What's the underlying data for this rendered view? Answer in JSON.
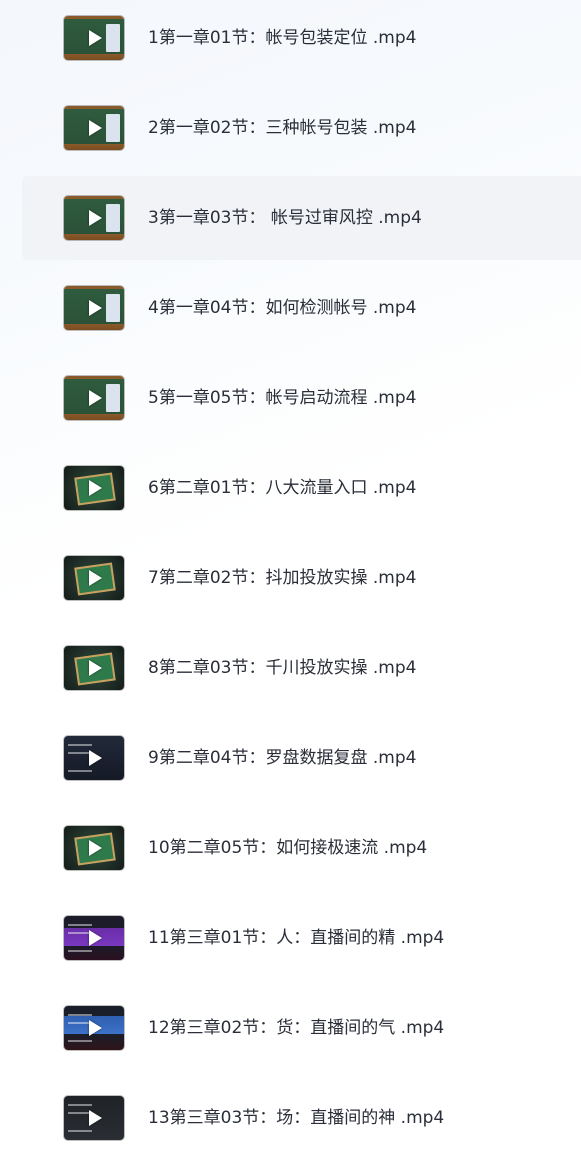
{
  "files": [
    {
      "name": "1第一章01节：帐号包装定位 .mp4",
      "thumb": "green",
      "icon": "play-icon",
      "selected": false
    },
    {
      "name": "2第一章02节：三种帐号包装 .mp4",
      "thumb": "green",
      "icon": "play-icon",
      "selected": false
    },
    {
      "name": "3第一章03节： 帐号过审风控 .mp4",
      "thumb": "green",
      "icon": "play-icon",
      "selected": true
    },
    {
      "name": "4第一章04节：如何检测帐号 .mp4",
      "thumb": "green",
      "icon": "play-icon",
      "selected": false
    },
    {
      "name": "5第一章05节：帐号启动流程 .mp4",
      "thumb": "green",
      "icon": "play-icon",
      "selected": false
    },
    {
      "name": "6第二章01节：八大流量入口 .mp4",
      "thumb": "board",
      "icon": "play-icon",
      "selected": false
    },
    {
      "name": "7第二章02节：抖加投放实操 .mp4",
      "thumb": "board",
      "icon": "play-icon",
      "selected": false
    },
    {
      "name": "8第二章03节：千川投放实操 .mp4",
      "thumb": "board",
      "icon": "play-icon",
      "selected": false
    },
    {
      "name": "9第二章04节：罗盘数据复盘 .mp4",
      "thumb": "dark",
      "icon": "play-icon",
      "selected": false
    },
    {
      "name": "10第二章05节：如何接极速流 .mp4",
      "thumb": "board",
      "icon": "play-icon",
      "selected": false
    },
    {
      "name": "11第三章01节：人：直播间的精 .mp4",
      "thumb": "purple",
      "icon": "play-icon",
      "selected": false
    },
    {
      "name": "12第三章02节：货：直播间的气 .mp4",
      "thumb": "blue",
      "icon": "play-icon",
      "selected": false
    },
    {
      "name": "13第三章03节：场：直播间的神 .mp4",
      "thumb": "black",
      "icon": "play-icon",
      "selected": false
    }
  ],
  "colors": {
    "selected_bg": "#f2f3f6",
    "text": "#2a2e38"
  }
}
